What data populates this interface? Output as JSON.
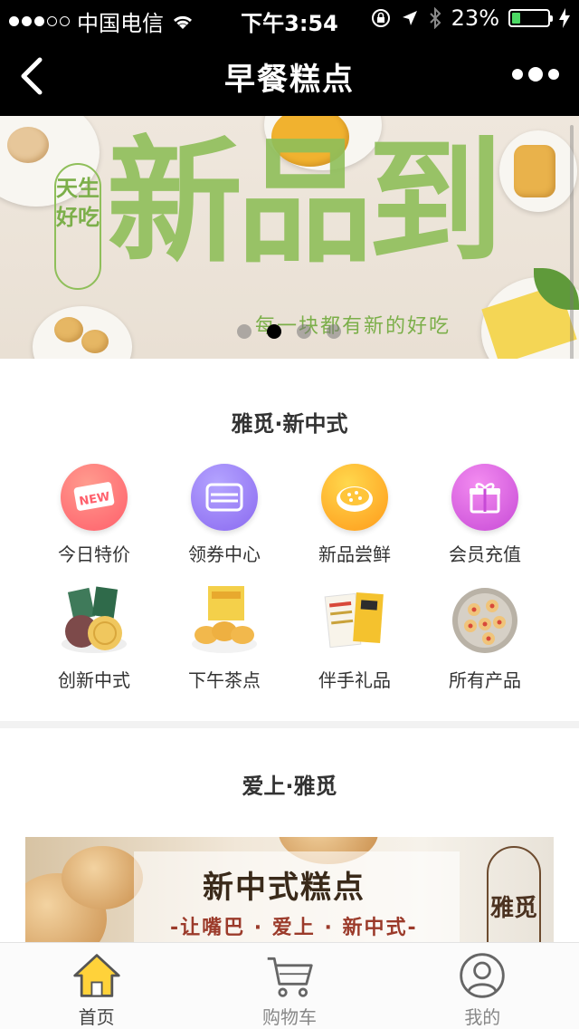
{
  "status_bar": {
    "carrier": "中国电信",
    "time": "下午3:54",
    "battery": "23%",
    "battery_level": 0.23
  },
  "nav": {
    "title": "早餐糕点",
    "back_icon": "chevron-left-icon",
    "more_icon": "more-dots-icon"
  },
  "banner": {
    "headline": "新品到",
    "side_text": "天生好吃",
    "subtitle": "每一块都有新的好吃",
    "slide_count": 4,
    "active_slide": 1
  },
  "section1": {
    "title": "雅觅·新中式",
    "items": [
      {
        "label": "今日特价",
        "icon": "new-tag-icon",
        "color": "#ff6f6f"
      },
      {
        "label": "领券中心",
        "icon": "coupon-icon",
        "color": "#9b7cf6"
      },
      {
        "label": "新品尝鲜",
        "icon": "pie-icon",
        "color": "#ffb21f"
      },
      {
        "label": "会员充值",
        "icon": "gift-icon",
        "color": "#e05fd9"
      },
      {
        "label": "创新中式",
        "icon": "mooncake-photo-icon"
      },
      {
        "label": "下午茶点",
        "icon": "pastry-photo-icon"
      },
      {
        "label": "伴手礼品",
        "icon": "gift-box-photo-icon"
      },
      {
        "label": "所有产品",
        "icon": "cookie-plate-photo-icon"
      }
    ]
  },
  "section2": {
    "title": "爱上·雅觅",
    "promo_headline": "新中式糕点",
    "promo_tagline": "-让嘴巴 · 爱上 · 新中式-",
    "promo_seal": "雅觅"
  },
  "tabs": [
    {
      "label": "首页",
      "icon": "home-icon",
      "active": true
    },
    {
      "label": "购物车",
      "icon": "cart-icon",
      "active": false
    },
    {
      "label": "我的",
      "icon": "user-icon",
      "active": false
    }
  ],
  "colors": {
    "nav_bg": "#000000",
    "home_active": "#ffd23a",
    "banner_text": "#8fbf5a"
  }
}
